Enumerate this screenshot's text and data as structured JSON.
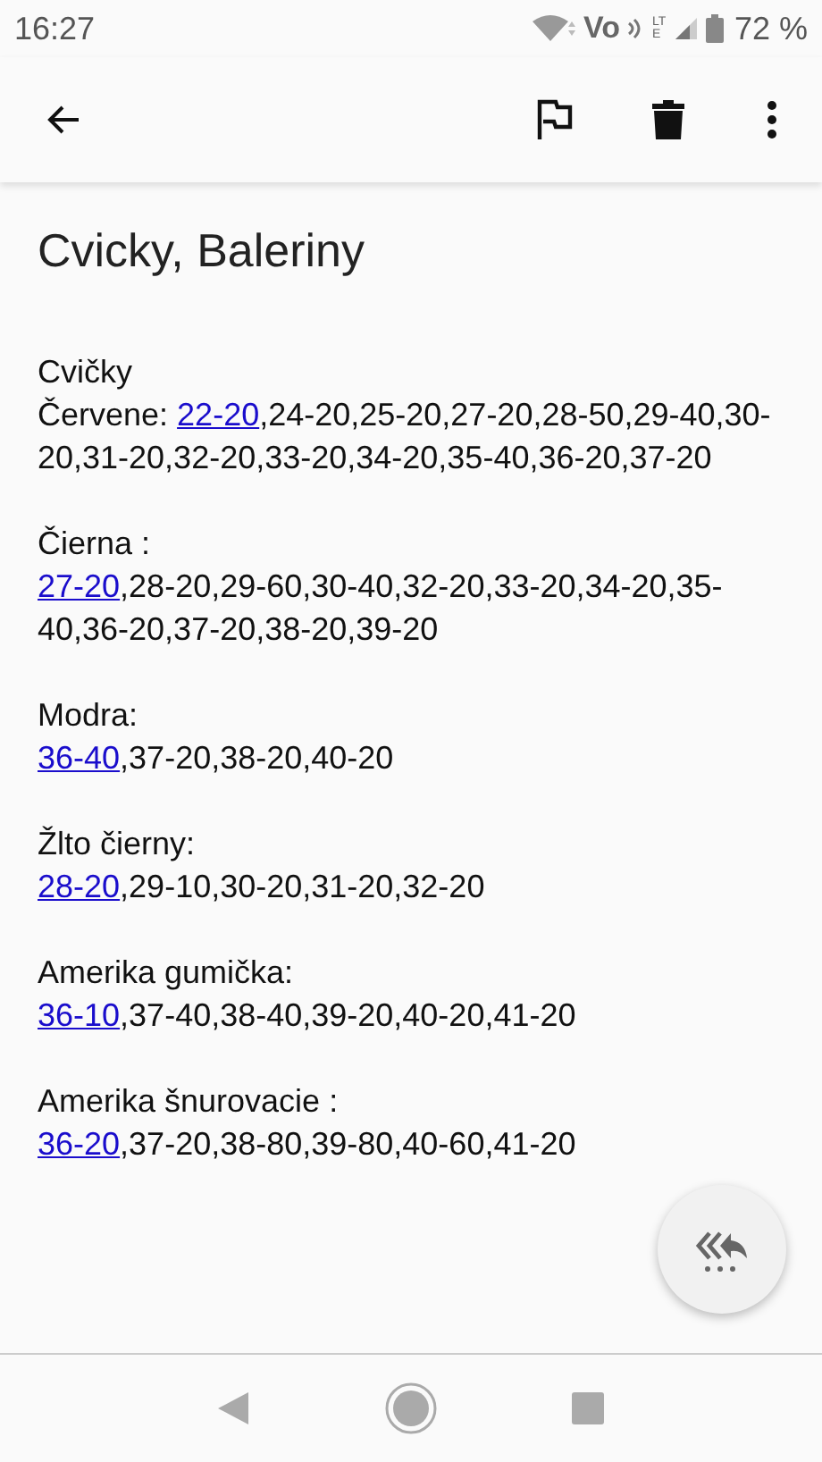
{
  "status_bar": {
    "time": "16:27",
    "network_label": "Vo",
    "network_type": "LTE",
    "battery": "72 %"
  },
  "title": "Cvicky, Baleriny",
  "sections": [
    {
      "heading": "Cvičky",
      "prefix": "Červene:",
      "link": "22-20",
      "rest": ",24-20,25-20,27-20,28-50,29-40,30-20,31-20,32-20,33-20,34-20,35-40,36-20,37-20"
    },
    {
      "heading": "Čierna :",
      "link": "27-20",
      "rest": ",28-20,29-60,30-40,32-20,33-20,34-20,35-40,36-20,37-20,38-20,39-20"
    },
    {
      "heading": "Modra:",
      "link": "36-40",
      "rest": ",37-20,38-20,40-20"
    },
    {
      "heading": "Žlto čierny:",
      "link": "28-20",
      "rest": ",29-10,30-20,31-20,32-20"
    },
    {
      "heading": "Amerika gumička:",
      "link": "36-10",
      "rest": ",37-40,38-40,39-20,40-20,41-20"
    },
    {
      "heading": "Amerika šnurovacie :",
      "link": "36-20",
      "rest": ",37-20,38-80,39-80,40-60,41-20"
    }
  ]
}
